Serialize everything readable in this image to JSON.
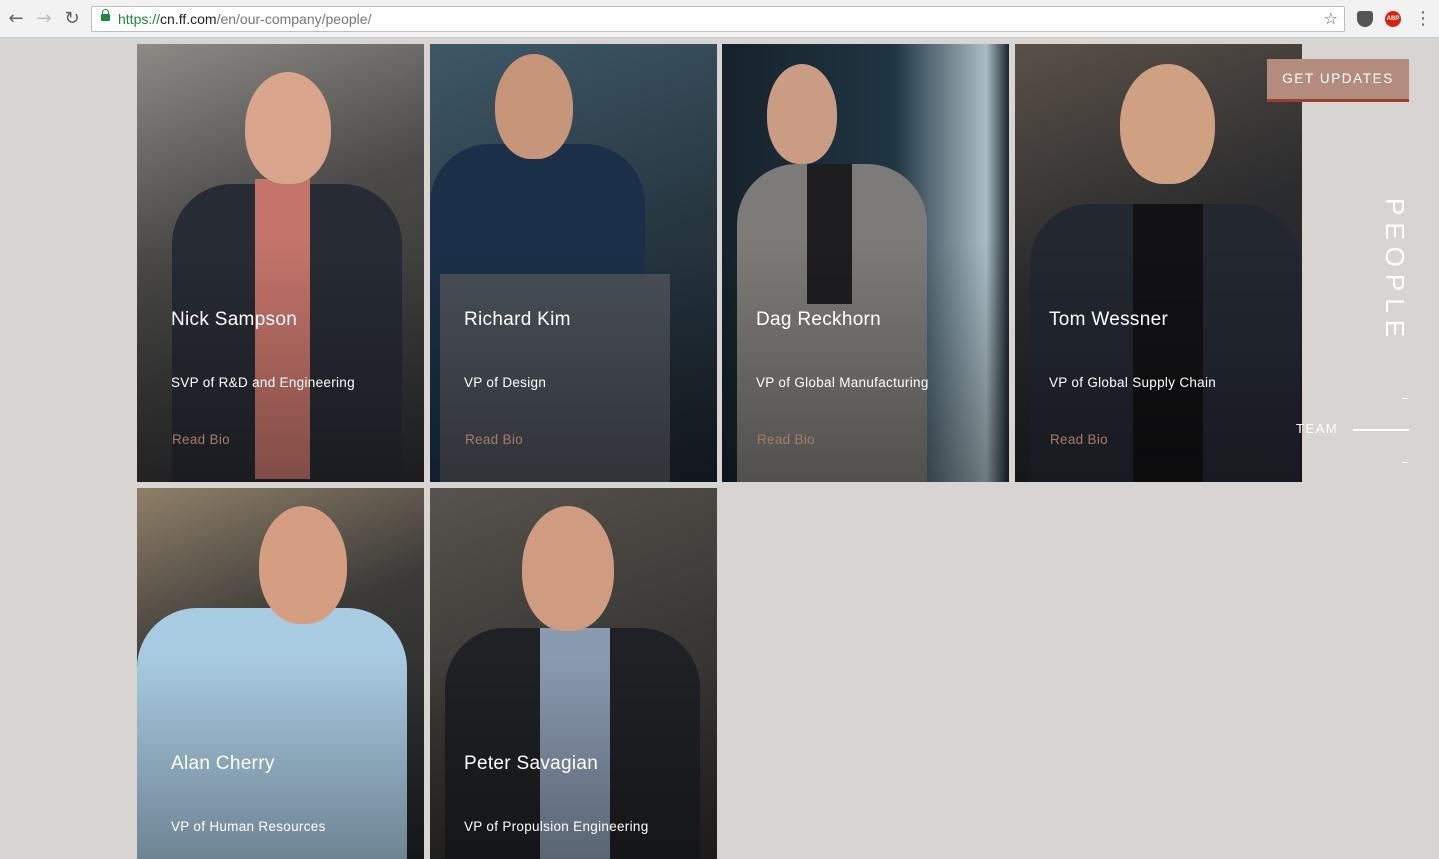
{
  "browser": {
    "url_scheme": "https://",
    "url_host": "cn.ff.com",
    "url_path": "/en/our-company/people/",
    "icons": [
      "back-icon",
      "forward-icon",
      "reload-icon",
      "lock-icon",
      "star-icon",
      "pocket-icon",
      "adblock-icon",
      "menu-icon"
    ],
    "abp_label": "ABP"
  },
  "people": [
    {
      "name": "Nick Sampson",
      "role": "SVP of R&D and Engineering",
      "link": "Read Bio"
    },
    {
      "name": "Richard Kim",
      "role": "VP of Design",
      "link": "Read Bio"
    },
    {
      "name": "Dag Reckhorn",
      "role": "VP of Global Manufacturing",
      "link": "Read Bio"
    },
    {
      "name": "Tom Wessner",
      "role": "VP of Global Supply Chain",
      "link": "Read Bio"
    },
    {
      "name": "Alan Cherry",
      "role": "VP of Human Resources",
      "link": ""
    },
    {
      "name": "Peter Savagian",
      "role": "VP of Propulsion Engineering",
      "link": ""
    }
  ],
  "sidebar": {
    "cta_label": "GET UPDATES",
    "section_label": "PEOPLE",
    "nav_items": [
      {
        "label": "TEAM"
      }
    ]
  },
  "colors": {
    "page_bg": "#d8d4d2",
    "cta_bg": "#b48c7f",
    "cta_underline": "#9c3f2a",
    "link_color": "#a87a68"
  }
}
